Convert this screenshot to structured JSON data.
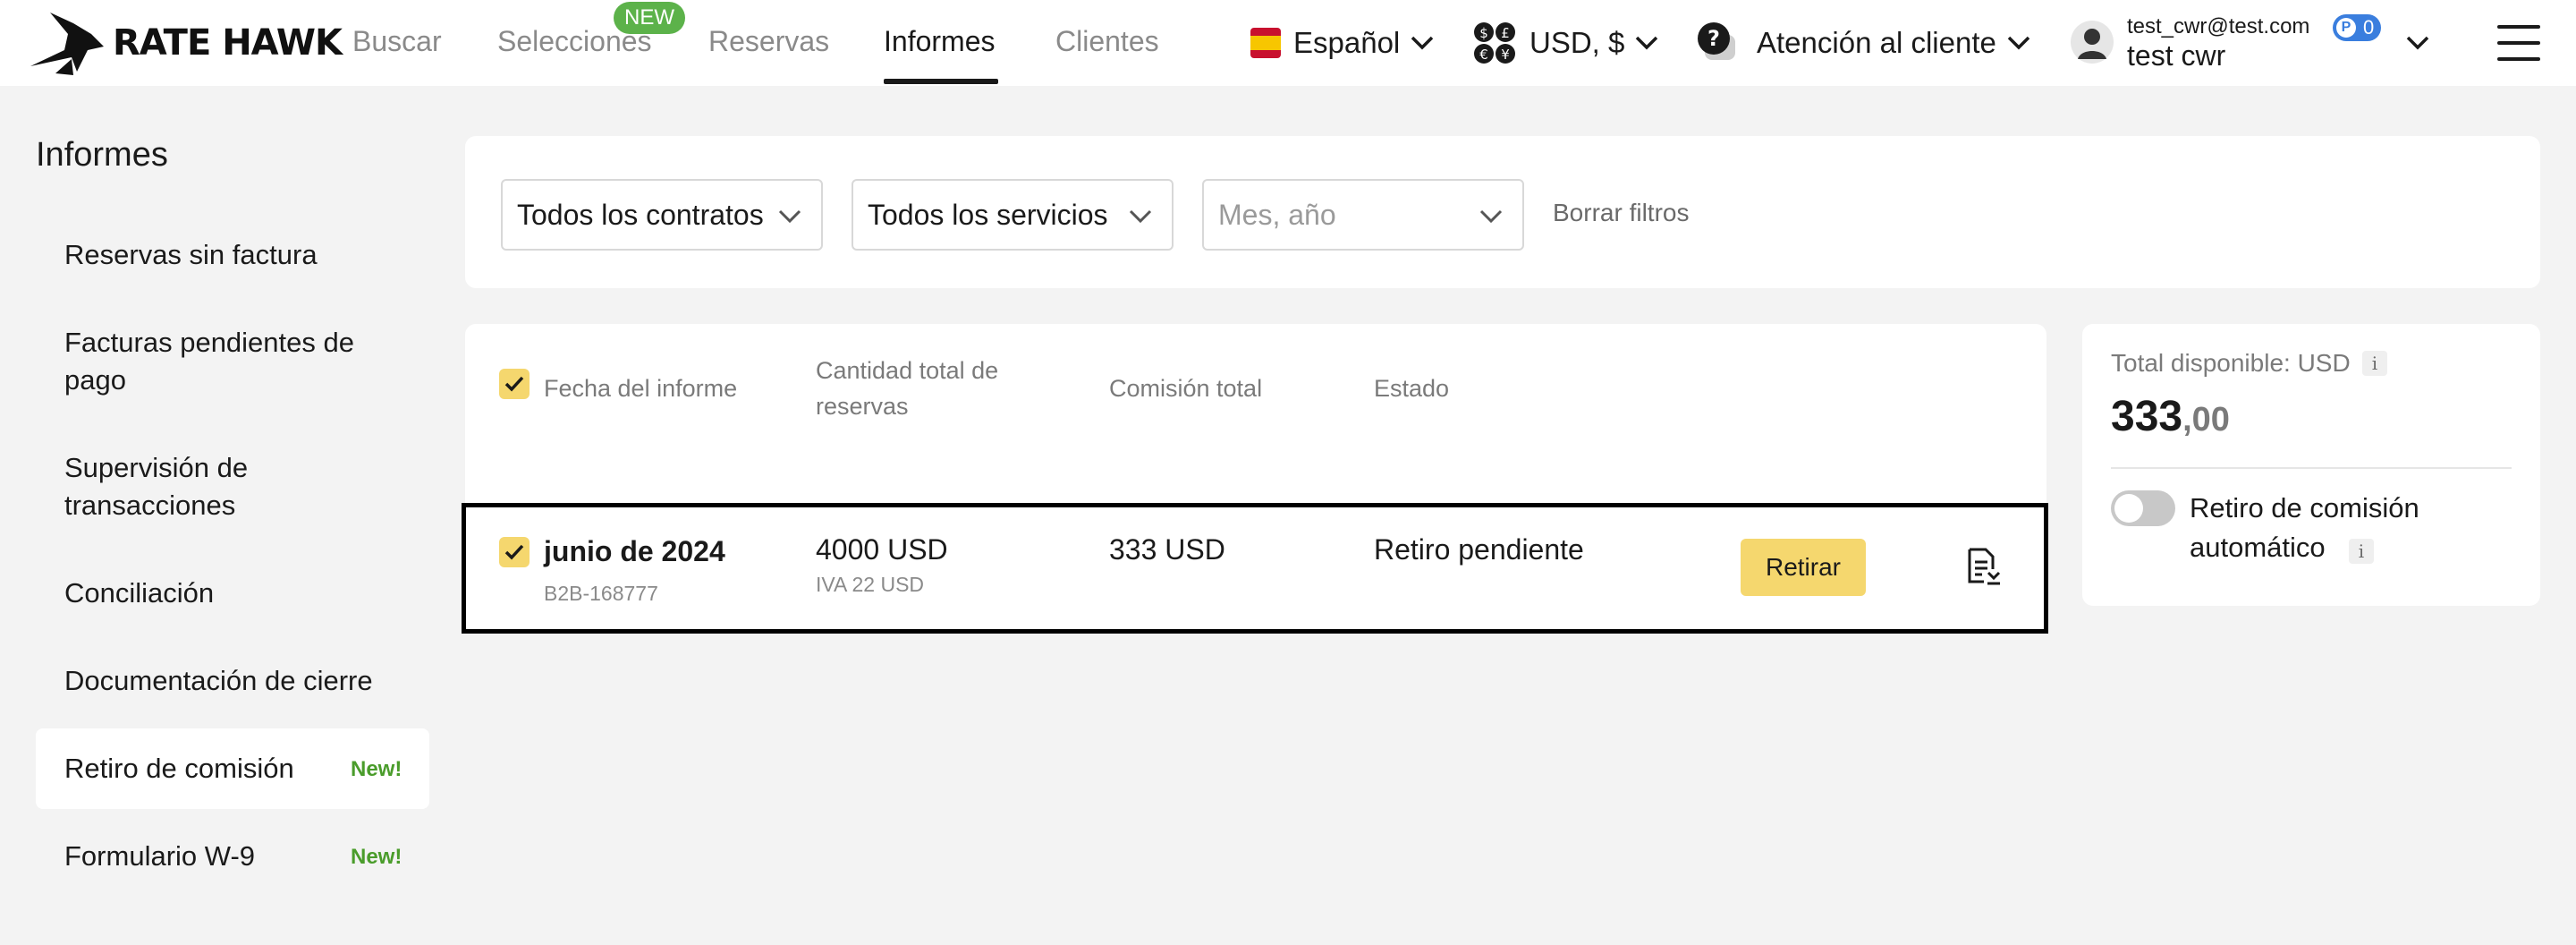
{
  "header": {
    "logo_text": "RATE HAWK",
    "nav": [
      {
        "label": "Buscar"
      },
      {
        "label": "Selecciones",
        "badge": "NEW"
      },
      {
        "label": "Reservas"
      },
      {
        "label": "Informes",
        "active": true
      },
      {
        "label": "Clientes"
      }
    ],
    "language": "Español",
    "currency": "USD, $",
    "support": "Atención al cliente",
    "user": {
      "email": "test_cwr@test.com",
      "name": "test cwr",
      "points": "0"
    }
  },
  "sidebar": {
    "title": "Informes",
    "items": [
      {
        "label": "Reservas sin factura"
      },
      {
        "label": "Facturas pendientes de pago"
      },
      {
        "label": "Supervisión de transacciones"
      },
      {
        "label": "Conciliación"
      },
      {
        "label": "Documentación de cierre"
      },
      {
        "label": "Retiro de comisión",
        "badge": "New!",
        "active": true
      },
      {
        "label": "Formulario W-9",
        "badge": "New!"
      }
    ]
  },
  "filters": {
    "contracts": "Todos los contratos",
    "services": "Todos los servicios",
    "month_placeholder": "Mes, año",
    "clear": "Borrar filtros"
  },
  "table": {
    "headers": {
      "date": "Fecha del informe",
      "total_bookings": "Cantidad total de reservas",
      "total_commission": "Comisión total",
      "status": "Estado"
    },
    "rows": [
      {
        "date": "junio de 2024",
        "id": "B2B-168777",
        "total": "4000 USD",
        "vat": "IVA 22 USD",
        "commission": "333 USD",
        "status": "Retiro pendiente",
        "action": "Retirar",
        "checked": true
      }
    ]
  },
  "summary": {
    "label": "Total disponible: USD",
    "amount_int": "333",
    "amount_dec": ",00",
    "auto_label": "Retiro de comisión automático",
    "auto_enabled": false
  },
  "colors": {
    "accent_yellow": "#f5d76e",
    "new_green": "#5cb24a",
    "points_blue": "#3a7ede"
  }
}
